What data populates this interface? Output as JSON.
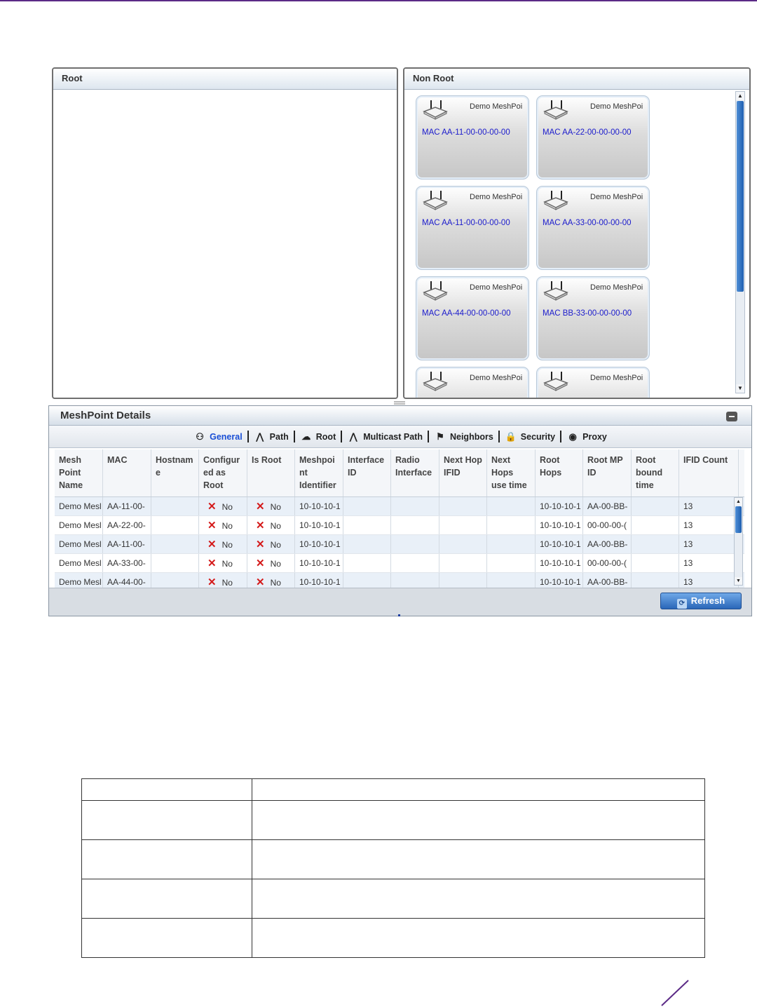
{
  "panels": {
    "root_title": "Root",
    "nonroot_title": "Non Root"
  },
  "meshpoints": [
    {
      "name": "Demo MeshPoi",
      "mac": "MAC AA-11-00-00-00-00"
    },
    {
      "name": "Demo MeshPoi",
      "mac": "MAC AA-22-00-00-00-00"
    },
    {
      "name": "Demo MeshPoi",
      "mac": "MAC AA-11-00-00-00-00"
    },
    {
      "name": "Demo MeshPoi",
      "mac": "MAC AA-33-00-00-00-00"
    },
    {
      "name": "Demo MeshPoi",
      "mac": "MAC AA-44-00-00-00-00"
    },
    {
      "name": "Demo MeshPoi",
      "mac": "MAC BB-33-00-00-00-00"
    },
    {
      "name": "Demo MeshPoi",
      "mac": ""
    },
    {
      "name": "Demo MeshPoi",
      "mac": ""
    }
  ],
  "details": {
    "title": "MeshPoint Details",
    "tabs": [
      {
        "label": "General",
        "icon": "general-icon"
      },
      {
        "label": "Path",
        "icon": "path-icon"
      },
      {
        "label": "Root",
        "icon": "root-icon"
      },
      {
        "label": "Multicast Path",
        "icon": "multicast-icon"
      },
      {
        "label": "Neighbors",
        "icon": "neighbors-icon"
      },
      {
        "label": "Security",
        "icon": "lock-icon"
      },
      {
        "label": "Proxy",
        "icon": "proxy-icon"
      }
    ],
    "columns": [
      "Mesh Point Name",
      "MAC",
      "Hostnam e",
      "Configur ed as Root",
      "Is Root",
      "Meshpoi nt Identifier",
      "Interface ID",
      "Radio Interface",
      "Next Hop IFID",
      "Next Hops use time",
      "Root Hops",
      "Root MP ID",
      "Root bound time",
      "IFID Count"
    ],
    "rows": [
      [
        "Demo Mesl",
        "AA-11-00-",
        "",
        "No",
        "No",
        "10-10-10-1",
        "",
        "",
        "",
        "",
        "10-10-10-1",
        "AA-00-BB-",
        "",
        "13"
      ],
      [
        "Demo Mesl",
        "AA-22-00-",
        "",
        "No",
        "No",
        "10-10-10-1",
        "",
        "",
        "",
        "",
        "10-10-10-1",
        "00-00-00-(",
        "",
        "13"
      ],
      [
        "Demo Mesl",
        "AA-11-00-",
        "",
        "No",
        "No",
        "10-10-10-1",
        "",
        "",
        "",
        "",
        "10-10-10-1",
        "AA-00-BB-",
        "",
        "13"
      ],
      [
        "Demo Mesl",
        "AA-33-00-",
        "",
        "No",
        "No",
        "10-10-10-1",
        "",
        "",
        "",
        "",
        "10-10-10-1",
        "00-00-00-(",
        "",
        "13"
      ],
      [
        "Demo Mesl",
        "AA-44-00-",
        "",
        "No",
        "No",
        "10-10-10-1",
        "",
        "",
        "",
        "",
        "10-10-10-1",
        "AA-00-BB-",
        "",
        "13"
      ]
    ],
    "refresh_label": "Refresh"
  },
  "colors": {
    "accent_purple": "#5b2a86",
    "link_blue": "#1a1acc",
    "no_mark_red": "#d41a1a",
    "button_blue": "#2a66b8"
  }
}
